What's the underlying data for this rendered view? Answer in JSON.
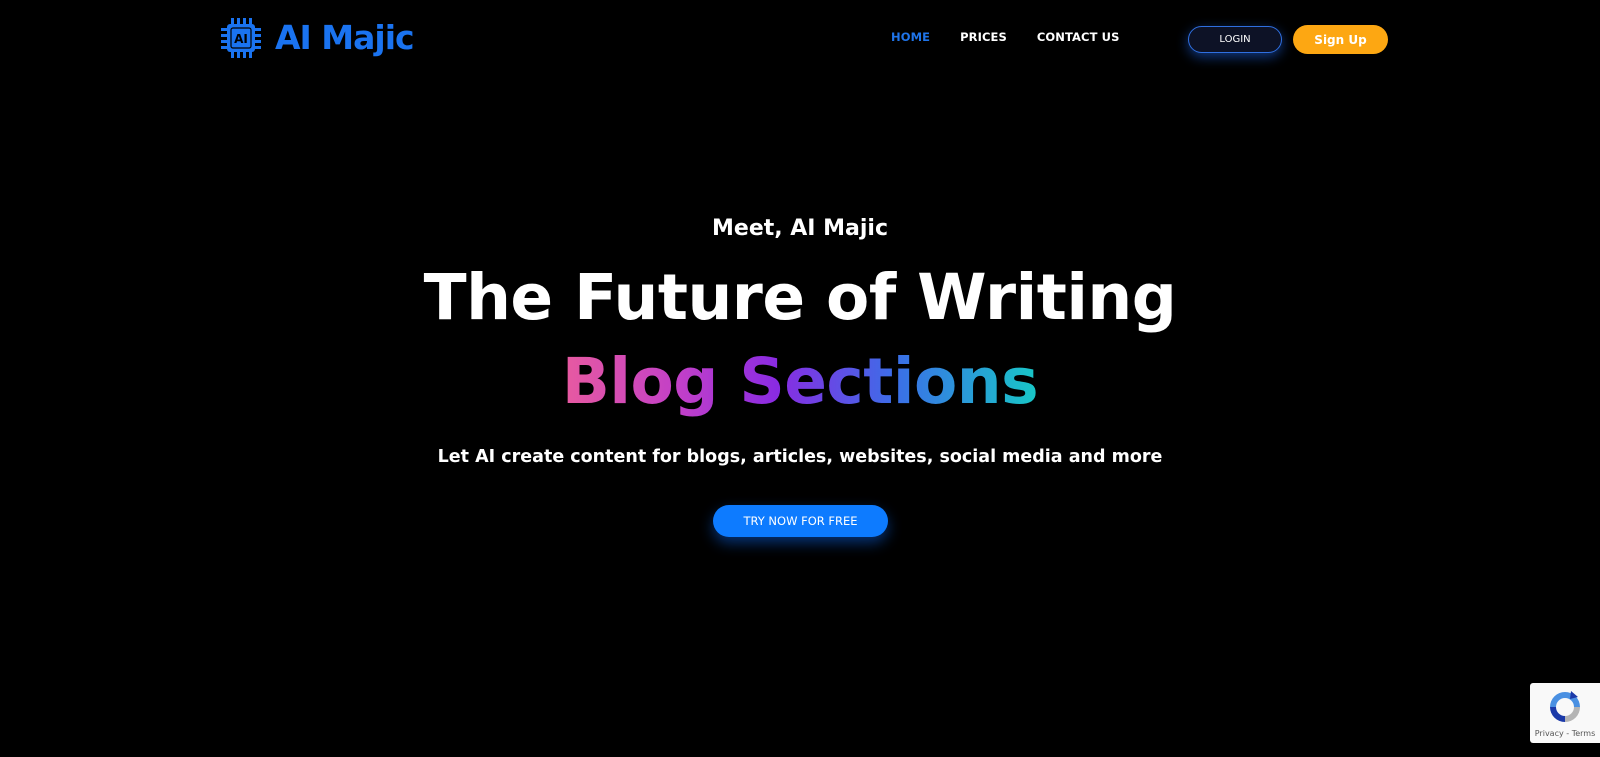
{
  "header": {
    "logo": {
      "icon_name": "cpu-chip-icon",
      "chip_text": "AI",
      "name": "AI Majic",
      "color": "#1a73f0"
    },
    "nav": [
      {
        "label": "HOME",
        "active": true
      },
      {
        "label": "PRICES",
        "active": false
      },
      {
        "label": "CONTACT US",
        "active": false
      }
    ],
    "login_label": "LOGIN",
    "signup_label": "Sign Up"
  },
  "hero": {
    "eyebrow": "Meet, AI Majic",
    "headline": "The Future of Writing",
    "rotating_word": "Blog Sections",
    "subline": "Let AI create content for blogs, articles, websites, social media and more",
    "cta_label": "TRY NOW FOR FREE"
  },
  "recaptcha": {
    "icon_name": "recaptcha-icon",
    "text": "Privacy - Terms"
  },
  "colors": {
    "background": "#000000",
    "accent_blue": "#1f74e9",
    "cta_blue": "#0d7bff",
    "signup_orange": "#fda712",
    "gradient": [
      "#e85aa0",
      "#c13fc9",
      "#8a2be2",
      "#3b6ee8",
      "#18c7c7"
    ]
  }
}
